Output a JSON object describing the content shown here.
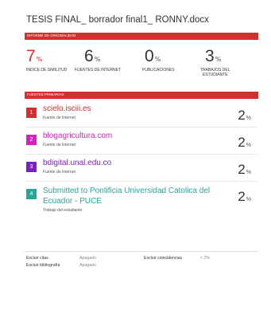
{
  "document": {
    "title": "TESIS FINAL_ borrador final1_ RONNY.docx"
  },
  "report": {
    "section_label": "INFORME DE ORIGINALIDAD"
  },
  "stats": [
    {
      "value": "7",
      "unit": "%",
      "label": "INDICE DE SIMILITUD"
    },
    {
      "value": "6",
      "unit": "%",
      "label": "FUENTES DE INTERNET"
    },
    {
      "value": "0",
      "unit": "%",
      "label": "PUBLICACIONES"
    },
    {
      "value": "3",
      "unit": "%",
      "label_line1": "TRABAJOS DEL",
      "label_line2": "ESTUDIANTE"
    }
  ],
  "sources_section": {
    "label": "FUENTES PRIMARIAS"
  },
  "sources": [
    {
      "rank": "1",
      "name": "scielo.isciii.es",
      "type": "Fuente de Internet",
      "value": "2",
      "unit": "%",
      "color": "#d32f2f"
    },
    {
      "rank": "2",
      "name": "blogagricultura.com",
      "type": "Fuente de Internet",
      "value": "2",
      "unit": "%",
      "color": "#d81fbf"
    },
    {
      "rank": "3",
      "name": "bdigital.unal.edu.co",
      "type": "Fuente de Internet",
      "value": "2",
      "unit": "%",
      "color": "#7b1fc9"
    },
    {
      "rank": "4",
      "name": "Submitted to Pontificia Universidad Catolica del Ecuador - PUCE",
      "type": "Trabajo del estudiante",
      "value": "2",
      "unit": "%",
      "color": "#26a69a"
    }
  ],
  "footer": {
    "exclude_quotes_label": "Excluir citas",
    "exclude_quotes_value": "Apagado",
    "exclude_bibliography_label": "Excluir bibliografía",
    "exclude_bibliography_value": "Apagado",
    "exclude_matches_label": "Excluir coincidencias",
    "exclude_matches_value": "< 2%"
  },
  "colors": {
    "accent": "#d32f2f",
    "link_pink": "#d81fbf",
    "link_purple": "#7b1fc9",
    "link_teal": "#26a69a"
  }
}
